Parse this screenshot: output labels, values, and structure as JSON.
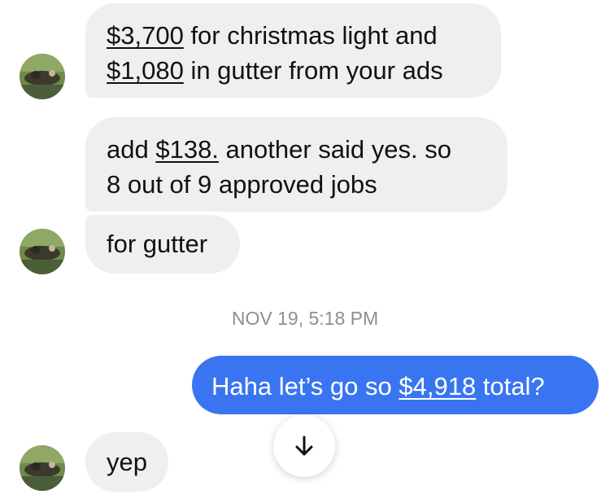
{
  "messages": [
    {
      "direction": "incoming",
      "lines": [
        {
          "money": "$3,700",
          "text": " for christmas light and"
        },
        {
          "money": "$1,080",
          "text": " in gutter from your ads"
        }
      ]
    },
    {
      "direction": "incoming",
      "line1_pre": "add ",
      "line1_money": "$138.",
      "line1_post": " another said yes. so",
      "line2": "8 out of 9 approved jobs"
    },
    {
      "direction": "incoming",
      "text": "for gutter"
    },
    {
      "direction": "outgoing",
      "pre": "Haha let’s go so ",
      "money": "$4,918",
      "post": " total?"
    },
    {
      "direction": "incoming",
      "text": "yep"
    }
  ],
  "timestamp": "NOV 19, 5:18 PM",
  "scroll_button": {
    "icon": "arrow-down-icon"
  },
  "colors": {
    "incoming_bubble": "#efefef",
    "outgoing_bubble": "#3a75f1",
    "timestamp_text": "#8e8e93"
  }
}
